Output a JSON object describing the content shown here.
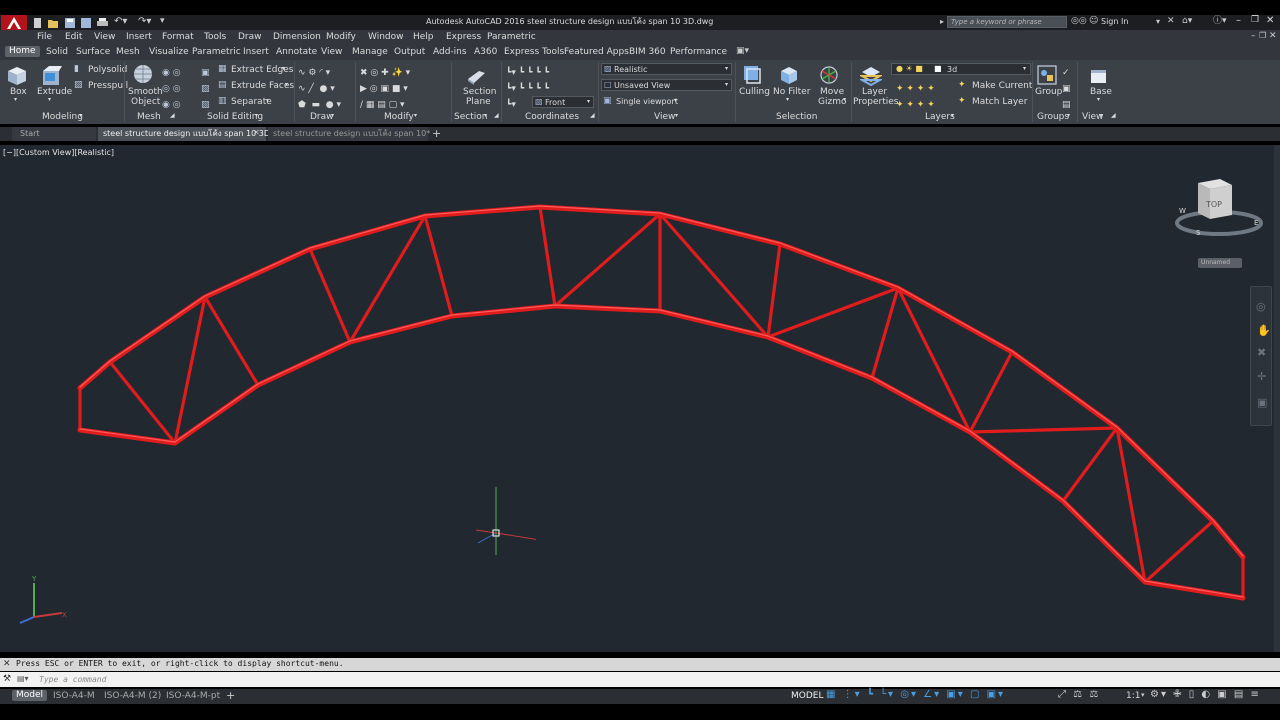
{
  "app": {
    "title": "Autodesk AutoCAD 2016    steel structure design แบบโค้ง span 10 3D.dwg",
    "search_placeholder": "Type a keyword or phrase",
    "sign_in": "Sign In"
  },
  "menu": [
    "File",
    "Edit",
    "View",
    "Insert",
    "Format",
    "Tools",
    "Draw",
    "Dimension",
    "Modify",
    "Window",
    "Help",
    "Express",
    "Parametric"
  ],
  "ribbon_tabs": [
    "Home",
    "Solid",
    "Surface",
    "Mesh",
    "Visualize",
    "Parametric",
    "Insert",
    "Annotate",
    "View",
    "Manage",
    "Output",
    "Add-ins",
    "A360",
    "Express Tools",
    "Featured Apps",
    "BIM 360",
    "Performance"
  ],
  "ribbon": {
    "box": "Box",
    "extrude": "Extrude",
    "polysolid": "Polysolid",
    "presspull": "Presspull",
    "smooth_object": [
      "Smooth",
      "Object"
    ],
    "extract_edges": "Extract Edges",
    "extrude_faces": "Extrude Faces",
    "separate": "Separate",
    "section_plane": [
      "Section",
      "Plane"
    ],
    "visual_style": "Realistic",
    "view_name": "Unsaved View",
    "front": "Front",
    "single_viewport": "Single viewport",
    "culling": "Culling",
    "no_filter": "No Filter",
    "move_gizmo": [
      "Move",
      "Gizmo"
    ],
    "layer_properties": [
      "Layer",
      "Properties"
    ],
    "layer_name": "3d",
    "make_current": "Make Current",
    "match_layer": "Match Layer",
    "group": "Group",
    "base": "Base",
    "panels": [
      "Modeling",
      "Mesh",
      "Solid Editing",
      "Draw",
      "Modify",
      "Section",
      "Coordinates",
      "View",
      "Selection",
      "Layers",
      "Groups",
      "View"
    ]
  },
  "doc_tabs": [
    "Start",
    "steel structure design แบบโค้ง span 10 3D*",
    "steel structure design แบบโค้ง span 10*"
  ],
  "viewport": {
    "label": "[−][Custom View][Realistic]",
    "viewcube_top": "TOP",
    "viewcube_compass": [
      "W",
      "S",
      "E"
    ],
    "ucs_name": "Unnamed",
    "ucs_axes": [
      "Y",
      "X"
    ],
    "model_color": "#e01c1c",
    "bg_color": "#212830"
  },
  "command": {
    "history": "Press ESC or ENTER to exit, or right-click to display shortcut-menu.",
    "placeholder": "Type a command"
  },
  "layout_tabs": [
    "Model",
    "ISO-A4-M",
    "ISO-A4-M (2)",
    "ISO-A4-M-pt"
  ],
  "status": {
    "model": "MODEL",
    "scale": "1:1"
  }
}
